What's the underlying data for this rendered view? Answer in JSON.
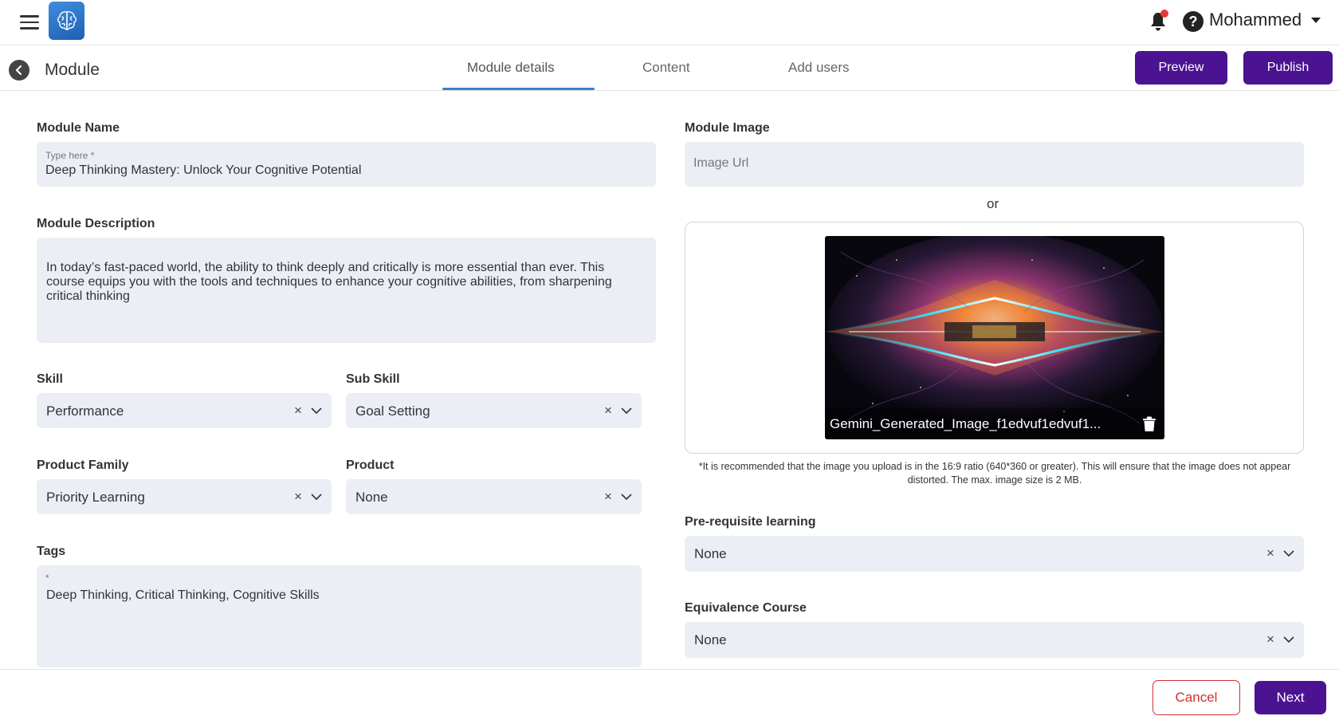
{
  "header": {
    "user_name": "Mohammed",
    "icons": [
      "hamburger-icon",
      "brain-logo-icon",
      "bell-icon",
      "help-icon",
      "caret-down-icon"
    ],
    "help_glyph": "?"
  },
  "subheader": {
    "title": "Module",
    "tabs": [
      {
        "label": "Module details",
        "active": true
      },
      {
        "label": "Content",
        "active": false
      },
      {
        "label": "Add users",
        "active": false
      }
    ],
    "preview_label": "Preview",
    "publish_label": "Publish"
  },
  "form": {
    "module_name": {
      "label": "Module Name",
      "small_label": "Type here *",
      "value": "Deep Thinking Mastery: Unlock Your Cognitive Potential"
    },
    "module_description": {
      "label": "Module Description",
      "value": "In today’s fast-paced world, the ability to think deeply and critically is more essential than ever. This course equips you with the tools and techniques to enhance your cognitive abilities, from sharpening critical thinking"
    },
    "skill": {
      "label": "Skill",
      "value": "Performance",
      "clear": "×"
    },
    "sub_skill": {
      "label": "Sub Skill",
      "value": "Goal Setting",
      "clear": "×"
    },
    "product_family": {
      "label": "Product Family",
      "value": "Priority Learning",
      "clear": "×"
    },
    "product": {
      "label": "Product",
      "value": "None",
      "clear": "×"
    },
    "tags": {
      "label": "Tags",
      "small_label": "*",
      "value": "Deep Thinking, Critical Thinking, Cognitive Skills"
    },
    "module_image": {
      "label": "Module Image",
      "placeholder": "Image Url",
      "or_text": "or",
      "file_name": "Gemini_Generated_Image_f1edvuf1edvuf1...",
      "note": "*It is recommended that the image you upload is in the 16:9 ratio (640*360 or greater). This will ensure that the image does not appear distorted. The max. image size is 2 MB."
    },
    "prerequisite": {
      "label": "Pre-requisite learning",
      "value": "None",
      "clear": "×"
    },
    "equivalence": {
      "label": "Equivalence Course",
      "value": "None",
      "clear": "×"
    }
  },
  "footer": {
    "cancel_label": "Cancel",
    "next_label": "Next"
  },
  "colors": {
    "primary": "#4b1391",
    "tab_underline": "#3f7dd0",
    "cancel": "#d32f2f",
    "field_bg": "#eceef5"
  }
}
